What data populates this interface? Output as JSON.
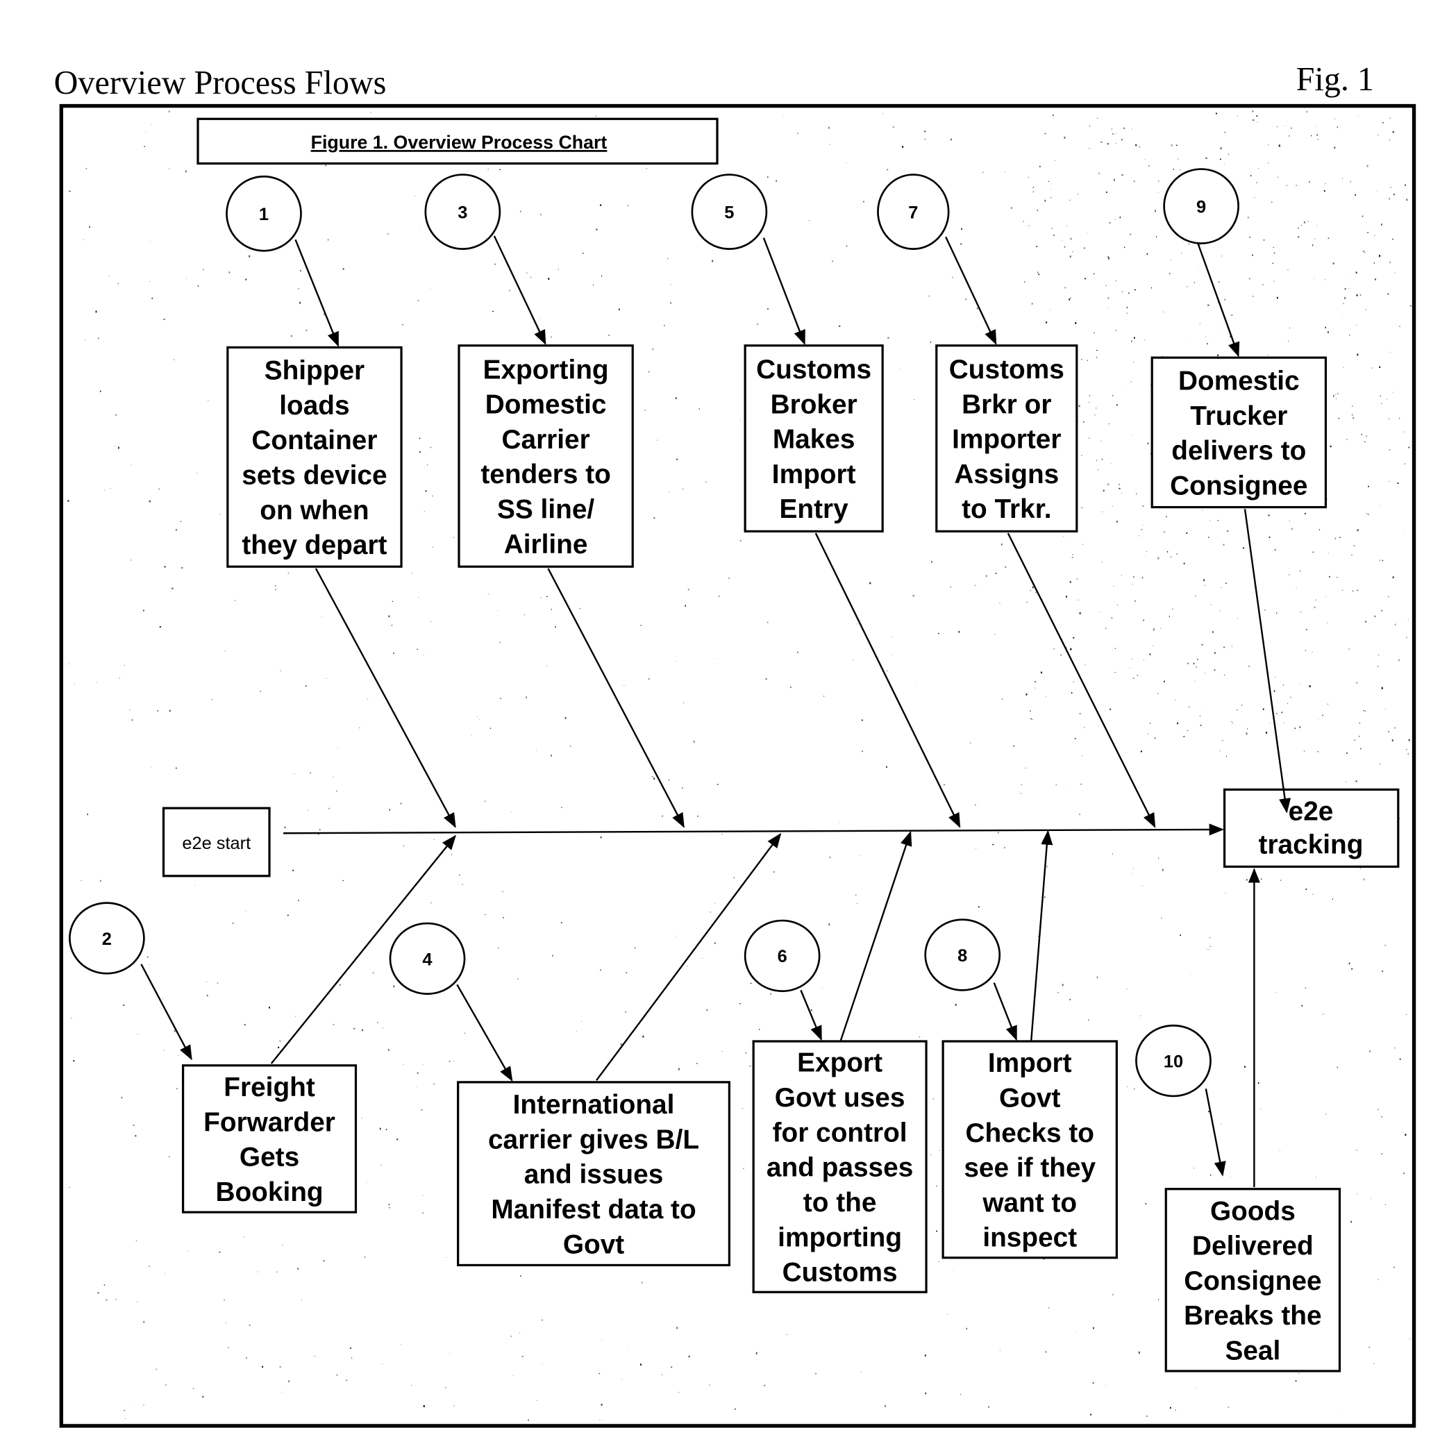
{
  "header": {
    "title": "Overview Process Flows",
    "figure_label": "Fig. 1"
  },
  "diagram": {
    "caption": "Figure 1. Overview Process Chart",
    "start_label": "e2e start",
    "end_label": [
      "e2e",
      "tracking"
    ],
    "steps": [
      {
        "number": "1",
        "position": "top",
        "lines": [
          "Shipper",
          "loads",
          "Container",
          "sets device",
          "on when",
          "they depart"
        ]
      },
      {
        "number": "2",
        "position": "bottom",
        "lines": [
          "Freight",
          "Forwarder",
          "Gets",
          "Booking"
        ]
      },
      {
        "number": "3",
        "position": "top",
        "lines": [
          "Exporting",
          "Domestic",
          "Carrier",
          "tenders to",
          "SS line/",
          "Airline"
        ]
      },
      {
        "number": "4",
        "position": "bottom",
        "lines": [
          "International",
          "carrier gives B/L",
          "and issues",
          "Manifest data to",
          "Govt"
        ]
      },
      {
        "number": "5",
        "position": "top",
        "lines": [
          "Customs",
          "Broker",
          "Makes",
          "Import",
          "Entry"
        ]
      },
      {
        "number": "6",
        "position": "bottom",
        "lines": [
          "Export",
          "Govt uses",
          "for control",
          "and passes",
          "to the",
          "importing",
          "Customs"
        ]
      },
      {
        "number": "7",
        "position": "top",
        "lines": [
          "Customs",
          "Brkr or",
          "Importer",
          "Assigns",
          "to Trkr."
        ]
      },
      {
        "number": "8",
        "position": "bottom",
        "lines": [
          "Import",
          "Govt",
          "Checks to",
          "see if they",
          "want to",
          "inspect"
        ]
      },
      {
        "number": "9",
        "position": "top",
        "lines": [
          "Domestic",
          "Trucker",
          "delivers to",
          "Consignee"
        ]
      },
      {
        "number": "10",
        "position": "bottom",
        "lines": [
          "Goods",
          "Delivered",
          "Consignee",
          "Breaks the",
          "Seal"
        ]
      }
    ]
  }
}
